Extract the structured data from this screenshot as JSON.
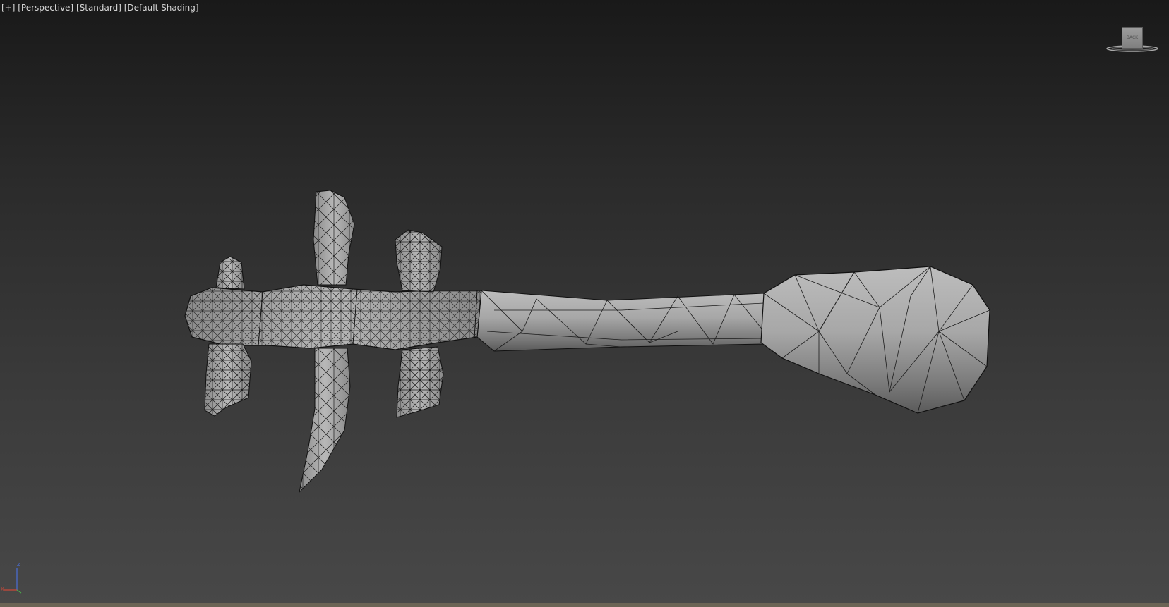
{
  "viewport": {
    "menu_label": "[+]",
    "view_label": "[Perspective]",
    "camera_label": "[Standard]",
    "shading_label": "[Default Shading]"
  },
  "viewcube": {
    "face_label": "BACK"
  },
  "axis": {
    "x_label": "X",
    "z_label": "Z"
  },
  "colors": {
    "axis_x": "#c84a3a",
    "axis_y": "#4aaa4a",
    "axis_z": "#4a6ed8"
  }
}
